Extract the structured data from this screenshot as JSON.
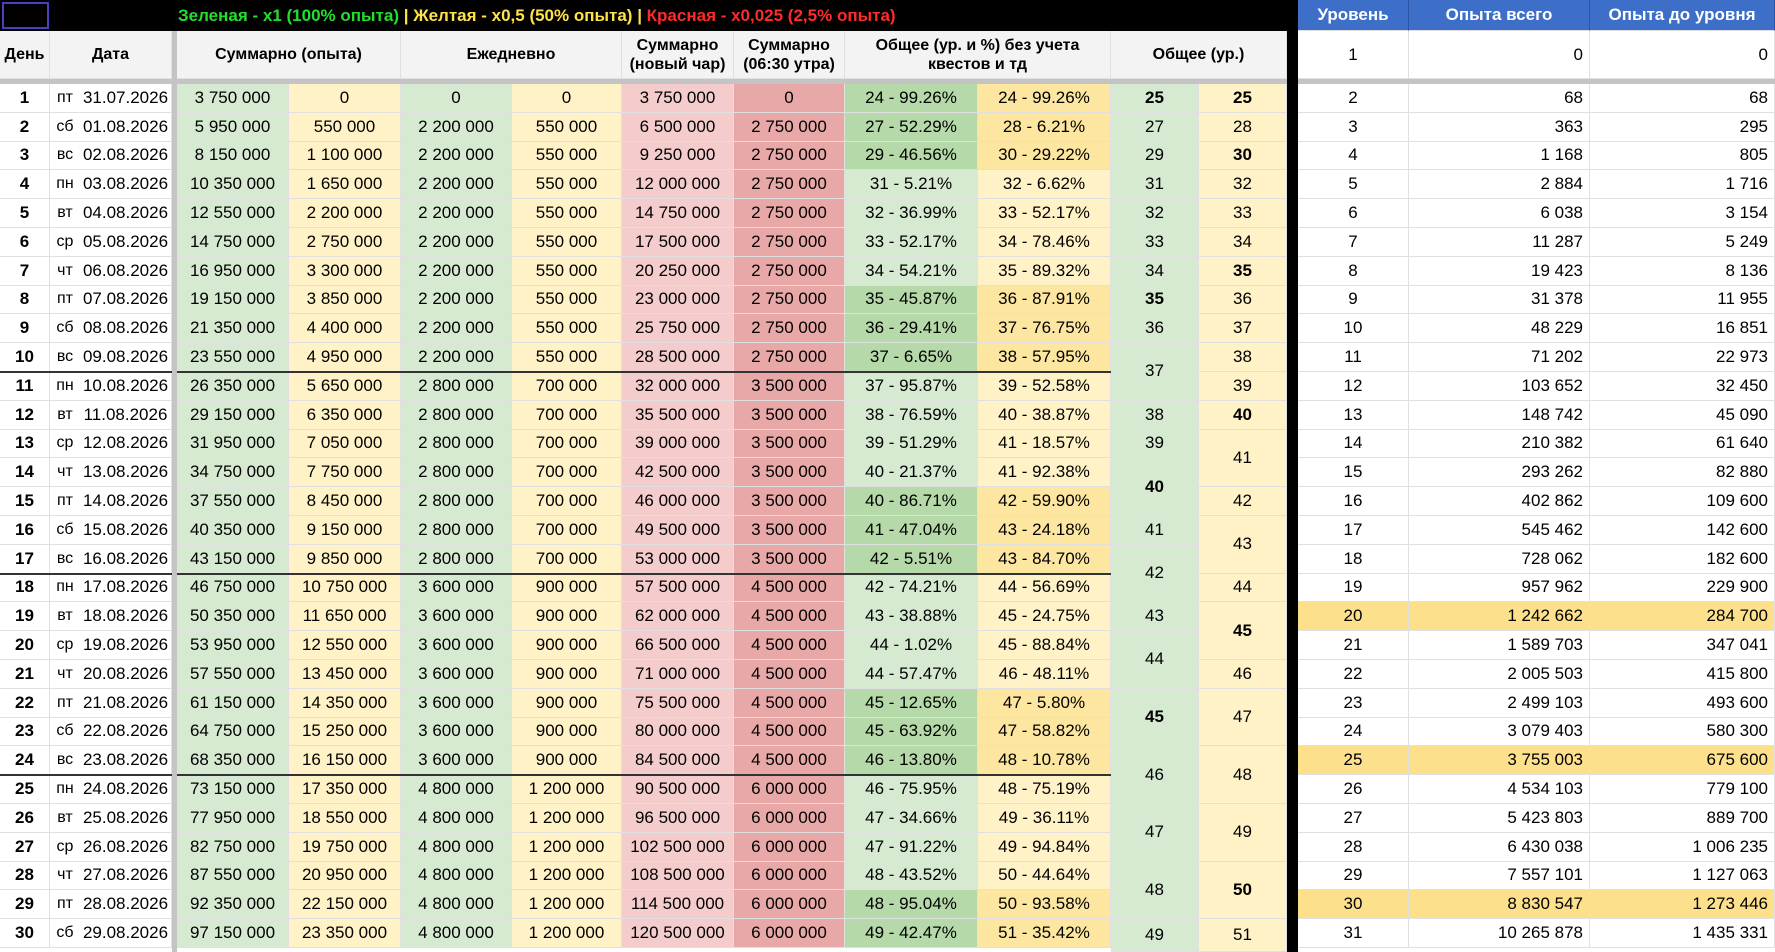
{
  "legend": {
    "green": "Зеленая - x1 (100% опыта)",
    "sep1": " | ",
    "yellow": "Желтая - x0,5 (50% опыта)",
    "sep2": " | ",
    "red": "Красная - x0,025 (2,5% опыта)"
  },
  "colors": {
    "green_text": "#22e02a",
    "yellow_text": "#ffe24a",
    "red_text": "#ff2a2a",
    "header_blue": "#3d6fc8",
    "green_fill": "#d6ead2",
    "green_dark_fill": "#b5d9a8",
    "yellow_fill": "#fff2c6",
    "yellow_dark_fill": "#fde6a0",
    "red_fill": "#f4cccc",
    "red_dark_fill": "#e8a8a8",
    "highlight_row": "#fce08c"
  },
  "headers": {
    "day": "День",
    "date": "Дата",
    "cumulative": "Суммарно (опыта)",
    "daily": "Ежедневно",
    "cum_new_char": "Суммарно (новый чар)",
    "cum_morning": "Суммарно (06:30 утра)",
    "overall_pct": "Общее (ур. и %) без учета квестов и тд",
    "overall_lvl": "Общее (ур.)"
  },
  "level_headers": {
    "level": "Уровень",
    "exp_total": "Опыта всего",
    "exp_to_level": "Опыта до уровня"
  },
  "level_first_row": {
    "level": "1",
    "total": "0",
    "to_level": "0"
  },
  "rows": [
    {
      "day": "1",
      "wd": "пт",
      "date": "31.07.2026",
      "cg": "3 750 000",
      "cy": "0",
      "dg": "0",
      "dy": "0",
      "nc": "3 750 000",
      "mr": "0",
      "pg": "24 - 99.26%",
      "py": "24 - 99.26%"
    },
    {
      "day": "2",
      "wd": "сб",
      "date": "01.08.2026",
      "cg": "5 950 000",
      "cy": "550 000",
      "dg": "2 200 000",
      "dy": "550 000",
      "nc": "6 500 000",
      "mr": "2 750 000",
      "pg": "27 - 52.29%",
      "py": "28 - 6.21%"
    },
    {
      "day": "3",
      "wd": "вс",
      "date": "02.08.2026",
      "cg": "8 150 000",
      "cy": "1 100 000",
      "dg": "2 200 000",
      "dy": "550 000",
      "nc": "9 250 000",
      "mr": "2 750 000",
      "pg": "29 - 46.56%",
      "py": "30 - 29.22%"
    },
    {
      "day": "4",
      "wd": "пн",
      "date": "03.08.2026",
      "cg": "10 350 000",
      "cy": "1 650 000",
      "dg": "2 200 000",
      "dy": "550 000",
      "nc": "12 000 000",
      "mr": "2 750 000",
      "pg": "31 - 5.21%",
      "py": "32 - 6.62%"
    },
    {
      "day": "5",
      "wd": "вт",
      "date": "04.08.2026",
      "cg": "12 550 000",
      "cy": "2 200 000",
      "dg": "2 200 000",
      "dy": "550 000",
      "nc": "14 750 000",
      "mr": "2 750 000",
      "pg": "32 - 36.99%",
      "py": "33 - 52.17%"
    },
    {
      "day": "6",
      "wd": "ср",
      "date": "05.08.2026",
      "cg": "14 750 000",
      "cy": "2 750 000",
      "dg": "2 200 000",
      "dy": "550 000",
      "nc": "17 500 000",
      "mr": "2 750 000",
      "pg": "33 - 52.17%",
      "py": "34 - 78.46%"
    },
    {
      "day": "7",
      "wd": "чт",
      "date": "06.08.2026",
      "cg": "16 950 000",
      "cy": "3 300 000",
      "dg": "2 200 000",
      "dy": "550 000",
      "nc": "20 250 000",
      "mr": "2 750 000",
      "pg": "34 - 54.21%",
      "py": "35 - 89.32%"
    },
    {
      "day": "8",
      "wd": "пт",
      "date": "07.08.2026",
      "cg": "19 150 000",
      "cy": "3 850 000",
      "dg": "2 200 000",
      "dy": "550 000",
      "nc": "23 000 000",
      "mr": "2 750 000",
      "pg": "35 - 45.87%",
      "py": "36 - 87.91%"
    },
    {
      "day": "9",
      "wd": "сб",
      "date": "08.08.2026",
      "cg": "21 350 000",
      "cy": "4 400 000",
      "dg": "2 200 000",
      "dy": "550 000",
      "nc": "25 750 000",
      "mr": "2 750 000",
      "pg": "36 - 29.41%",
      "py": "37 - 76.75%"
    },
    {
      "day": "10",
      "wd": "вс",
      "date": "09.08.2026",
      "cg": "23 550 000",
      "cy": "4 950 000",
      "dg": "2 200 000",
      "dy": "550 000",
      "nc": "28 500 000",
      "mr": "2 750 000",
      "pg": "37 - 6.65%",
      "py": "38 - 57.95%"
    },
    {
      "day": "11",
      "wd": "пн",
      "date": "10.08.2026",
      "cg": "26 350 000",
      "cy": "5 650 000",
      "dg": "2 800 000",
      "dy": "700 000",
      "nc": "32 000 000",
      "mr": "3 500 000",
      "pg": "37 - 95.87%",
      "py": "39 - 52.58%"
    },
    {
      "day": "12",
      "wd": "вт",
      "date": "11.08.2026",
      "cg": "29 150 000",
      "cy": "6 350 000",
      "dg": "2 800 000",
      "dy": "700 000",
      "nc": "35 500 000",
      "mr": "3 500 000",
      "pg": "38 - 76.59%",
      "py": "40 - 38.87%"
    },
    {
      "day": "13",
      "wd": "ср",
      "date": "12.08.2026",
      "cg": "31 950 000",
      "cy": "7 050 000",
      "dg": "2 800 000",
      "dy": "700 000",
      "nc": "39 000 000",
      "mr": "3 500 000",
      "pg": "39 - 51.29%",
      "py": "41 - 18.57%"
    },
    {
      "day": "14",
      "wd": "чт",
      "date": "13.08.2026",
      "cg": "34 750 000",
      "cy": "7 750 000",
      "dg": "2 800 000",
      "dy": "700 000",
      "nc": "42 500 000",
      "mr": "3 500 000",
      "pg": "40 - 21.37%",
      "py": "41 - 92.38%"
    },
    {
      "day": "15",
      "wd": "пт",
      "date": "14.08.2026",
      "cg": "37 550 000",
      "cy": "8 450 000",
      "dg": "2 800 000",
      "dy": "700 000",
      "nc": "46 000 000",
      "mr": "3 500 000",
      "pg": "40 - 86.71%",
      "py": "42 - 59.90%"
    },
    {
      "day": "16",
      "wd": "сб",
      "date": "15.08.2026",
      "cg": "40 350 000",
      "cy": "9 150 000",
      "dg": "2 800 000",
      "dy": "700 000",
      "nc": "49 500 000",
      "mr": "3 500 000",
      "pg": "41 - 47.04%",
      "py": "43 - 24.18%"
    },
    {
      "day": "17",
      "wd": "вс",
      "date": "16.08.2026",
      "cg": "43 150 000",
      "cy": "9 850 000",
      "dg": "2 800 000",
      "dy": "700 000",
      "nc": "53 000 000",
      "mr": "3 500 000",
      "pg": "42 - 5.51%",
      "py": "43 - 84.70%"
    },
    {
      "day": "18",
      "wd": "пн",
      "date": "17.08.2026",
      "cg": "46 750 000",
      "cy": "10 750 000",
      "dg": "3 600 000",
      "dy": "900 000",
      "nc": "57 500 000",
      "mr": "4 500 000",
      "pg": "42 - 74.21%",
      "py": "44 - 56.69%"
    },
    {
      "day": "19",
      "wd": "вт",
      "date": "18.08.2026",
      "cg": "50 350 000",
      "cy": "11 650 000",
      "dg": "3 600 000",
      "dy": "900 000",
      "nc": "62 000 000",
      "mr": "4 500 000",
      "pg": "43 - 38.88%",
      "py": "45 - 24.75%"
    },
    {
      "day": "20",
      "wd": "ср",
      "date": "19.08.2026",
      "cg": "53 950 000",
      "cy": "12 550 000",
      "dg": "3 600 000",
      "dy": "900 000",
      "nc": "66 500 000",
      "mr": "4 500 000",
      "pg": "44 - 1.02%",
      "py": "45 - 88.84%"
    },
    {
      "day": "21",
      "wd": "чт",
      "date": "20.08.2026",
      "cg": "57 550 000",
      "cy": "13 450 000",
      "dg": "3 600 000",
      "dy": "900 000",
      "nc": "71 000 000",
      "mr": "4 500 000",
      "pg": "44 - 57.47%",
      "py": "46 - 48.11%"
    },
    {
      "day": "22",
      "wd": "пт",
      "date": "21.08.2026",
      "cg": "61 150 000",
      "cy": "14 350 000",
      "dg": "3 600 000",
      "dy": "900 000",
      "nc": "75 500 000",
      "mr": "4 500 000",
      "pg": "45 - 12.65%",
      "py": "47 - 5.80%"
    },
    {
      "day": "23",
      "wd": "сб",
      "date": "22.08.2026",
      "cg": "64 750 000",
      "cy": "15 250 000",
      "dg": "3 600 000",
      "dy": "900 000",
      "nc": "80 000 000",
      "mr": "4 500 000",
      "pg": "45 - 63.92%",
      "py": "47 - 58.82%"
    },
    {
      "day": "24",
      "wd": "вс",
      "date": "23.08.2026",
      "cg": "68 350 000",
      "cy": "16 150 000",
      "dg": "3 600 000",
      "dy": "900 000",
      "nc": "84 500 000",
      "mr": "4 500 000",
      "pg": "46 - 13.80%",
      "py": "48 - 10.78%"
    },
    {
      "day": "25",
      "wd": "пн",
      "date": "24.08.2026",
      "cg": "73 150 000",
      "cy": "17 350 000",
      "dg": "4 800 000",
      "dy": "1 200 000",
      "nc": "90 500 000",
      "mr": "6 000 000",
      "pg": "46 - 75.95%",
      "py": "48 - 75.19%"
    },
    {
      "day": "26",
      "wd": "вт",
      "date": "25.08.2026",
      "cg": "77 950 000",
      "cy": "18 550 000",
      "dg": "4 800 000",
      "dy": "1 200 000",
      "nc": "96 500 000",
      "mr": "6 000 000",
      "pg": "47 - 34.66%",
      "py": "49 - 36.11%"
    },
    {
      "day": "27",
      "wd": "ср",
      "date": "26.08.2026",
      "cg": "82 750 000",
      "cy": "19 750 000",
      "dg": "4 800 000",
      "dy": "1 200 000",
      "nc": "102 500 000",
      "mr": "6 000 000",
      "pg": "47 - 91.22%",
      "py": "49 - 94.84%"
    },
    {
      "day": "28",
      "wd": "чт",
      "date": "27.08.2026",
      "cg": "87 550 000",
      "cy": "20 950 000",
      "dg": "4 800 000",
      "dy": "1 200 000",
      "nc": "108 500 000",
      "mr": "6 000 000",
      "pg": "48 - 43.52%",
      "py": "50 - 44.64%"
    },
    {
      "day": "29",
      "wd": "пт",
      "date": "28.08.2026",
      "cg": "92 350 000",
      "cy": "22 150 000",
      "dg": "4 800 000",
      "dy": "1 200 000",
      "nc": "114 500 000",
      "mr": "6 000 000",
      "pg": "48 - 95.04%",
      "py": "50 - 93.58%"
    },
    {
      "day": "30",
      "wd": "сб",
      "date": "29.08.2026",
      "cg": "97 150 000",
      "cy": "23 350 000",
      "dg": "4 800 000",
      "dy": "1 200 000",
      "nc": "120 500 000",
      "mr": "6 000 000",
      "pg": "49 - 42.47%",
      "py": "51 - 35.42%"
    }
  ],
  "pg_dark_rows": [
    "1",
    "2",
    "3",
    "8",
    "9",
    "10",
    "15",
    "16",
    "17",
    "22",
    "23",
    "24",
    "29",
    "30"
  ],
  "py_dark_rows": [
    "1",
    "2",
    "3",
    "8",
    "9",
    "10",
    "15",
    "16",
    "17",
    "22",
    "23",
    "24",
    "29",
    "30"
  ],
  "row_separators_after": [
    "10",
    "17",
    "24"
  ],
  "overall_green": [
    {
      "value": "25",
      "from": "1",
      "to": "1"
    },
    {
      "value": "27",
      "from": "2",
      "to": "2"
    },
    {
      "value": "29",
      "from": "3",
      "to": "3"
    },
    {
      "value": "31",
      "from": "4",
      "to": "4"
    },
    {
      "value": "32",
      "from": "5",
      "to": "5"
    },
    {
      "value": "33",
      "from": "6",
      "to": "6"
    },
    {
      "value": "34",
      "from": "7",
      "to": "7"
    },
    {
      "value": "35",
      "from": "8",
      "to": "8"
    },
    {
      "value": "36",
      "from": "9",
      "to": "9"
    },
    {
      "value": "37",
      "from": "10",
      "to": "11"
    },
    {
      "value": "38",
      "from": "12",
      "to": "12"
    },
    {
      "value": "39",
      "from": "13",
      "to": "13"
    },
    {
      "value": "40",
      "from": "14",
      "to": "15"
    },
    {
      "value": "41",
      "from": "16",
      "to": "16"
    },
    {
      "value": "42",
      "from": "17",
      "to": "18"
    },
    {
      "value": "43",
      "from": "19",
      "to": "19"
    },
    {
      "value": "44",
      "from": "20",
      "to": "21"
    },
    {
      "value": "45",
      "from": "22",
      "to": "23"
    },
    {
      "value": "46",
      "from": "24",
      "to": "25"
    },
    {
      "value": "47",
      "from": "26",
      "to": "27"
    },
    {
      "value": "48",
      "from": "28",
      "to": "29"
    },
    {
      "value": "49",
      "from": "30",
      "to": "31"
    }
  ],
  "overall_yellow": [
    {
      "value": "25",
      "from": "1",
      "to": "1"
    },
    {
      "value": "28",
      "from": "2",
      "to": "2"
    },
    {
      "value": "30",
      "from": "3",
      "to": "3"
    },
    {
      "value": "32",
      "from": "4",
      "to": "4"
    },
    {
      "value": "33",
      "from": "5",
      "to": "5"
    },
    {
      "value": "34",
      "from": "6",
      "to": "6"
    },
    {
      "value": "35",
      "from": "7",
      "to": "7"
    },
    {
      "value": "36",
      "from": "8",
      "to": "8"
    },
    {
      "value": "37",
      "from": "9",
      "to": "9"
    },
    {
      "value": "38",
      "from": "10",
      "to": "10"
    },
    {
      "value": "39",
      "from": "11",
      "to": "11"
    },
    {
      "value": "40",
      "from": "12",
      "to": "12"
    },
    {
      "value": "41",
      "from": "13",
      "to": "14"
    },
    {
      "value": "42",
      "from": "15",
      "to": "15"
    },
    {
      "value": "43",
      "from": "16",
      "to": "17"
    },
    {
      "value": "44",
      "from": "18",
      "to": "18"
    },
    {
      "value": "45",
      "from": "19",
      "to": "20"
    },
    {
      "value": "46",
      "from": "21",
      "to": "21"
    },
    {
      "value": "47",
      "from": "22",
      "to": "23"
    },
    {
      "value": "48",
      "from": "24",
      "to": "25"
    },
    {
      "value": "49",
      "from": "26",
      "to": "27"
    },
    {
      "value": "50",
      "from": "28",
      "to": "29"
    },
    {
      "value": "51",
      "from": "30",
      "to": "31"
    }
  ],
  "bold_overall": [
    "25",
    "30",
    "35",
    "40",
    "45",
    "50"
  ],
  "levels": [
    {
      "level": "2",
      "total": "68",
      "to_level": "68"
    },
    {
      "level": "3",
      "total": "363",
      "to_level": "295"
    },
    {
      "level": "4",
      "total": "1 168",
      "to_level": "805"
    },
    {
      "level": "5",
      "total": "2 884",
      "to_level": "1 716"
    },
    {
      "level": "6",
      "total": "6 038",
      "to_level": "3 154"
    },
    {
      "level": "7",
      "total": "11 287",
      "to_level": "5 249"
    },
    {
      "level": "8",
      "total": "19 423",
      "to_level": "8 136"
    },
    {
      "level": "9",
      "total": "31 378",
      "to_level": "11 955"
    },
    {
      "level": "10",
      "total": "48 229",
      "to_level": "16 851"
    },
    {
      "level": "11",
      "total": "71 202",
      "to_level": "22 973"
    },
    {
      "level": "12",
      "total": "103 652",
      "to_level": "32 450"
    },
    {
      "level": "13",
      "total": "148 742",
      "to_level": "45 090"
    },
    {
      "level": "14",
      "total": "210 382",
      "to_level": "61 640"
    },
    {
      "level": "15",
      "total": "293 262",
      "to_level": "82 880"
    },
    {
      "level": "16",
      "total": "402 862",
      "to_level": "109 600"
    },
    {
      "level": "17",
      "total": "545 462",
      "to_level": "142 600"
    },
    {
      "level": "18",
      "total": "728 062",
      "to_level": "182 600"
    },
    {
      "level": "19",
      "total": "957 962",
      "to_level": "229 900"
    },
    {
      "level": "20",
      "total": "1 242 662",
      "to_level": "284 700"
    },
    {
      "level": "21",
      "total": "1 589 703",
      "to_level": "347 041"
    },
    {
      "level": "22",
      "total": "2 005 503",
      "to_level": "415 800"
    },
    {
      "level": "23",
      "total": "2 499 103",
      "to_level": "493 600"
    },
    {
      "level": "24",
      "total": "3 079 403",
      "to_level": "580 300"
    },
    {
      "level": "25",
      "total": "3 755 003",
      "to_level": "675 600"
    },
    {
      "level": "26",
      "total": "4 534 103",
      "to_level": "779 100"
    },
    {
      "level": "27",
      "total": "5 423 803",
      "to_level": "889 700"
    },
    {
      "level": "28",
      "total": "6 430 038",
      "to_level": "1 006 235"
    },
    {
      "level": "29",
      "total": "7 557 101",
      "to_level": "1 127 063"
    },
    {
      "level": "30",
      "total": "8 830 547",
      "to_level": "1 273 446"
    },
    {
      "level": "31",
      "total": "10 265 878",
      "to_level": "1 435 331"
    }
  ],
  "highlight_levels": [
    "20",
    "25",
    "30"
  ]
}
